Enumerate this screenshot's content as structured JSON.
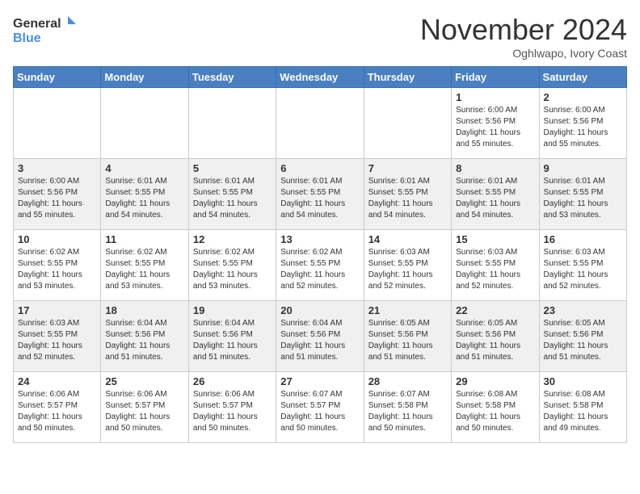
{
  "header": {
    "logo_general": "General",
    "logo_blue": "Blue",
    "month_title": "November 2024",
    "location": "Oghlwapo, Ivory Coast"
  },
  "days_of_week": [
    "Sunday",
    "Monday",
    "Tuesday",
    "Wednesday",
    "Thursday",
    "Friday",
    "Saturday"
  ],
  "weeks": [
    [
      {
        "day": "",
        "info": ""
      },
      {
        "day": "",
        "info": ""
      },
      {
        "day": "",
        "info": ""
      },
      {
        "day": "",
        "info": ""
      },
      {
        "day": "",
        "info": ""
      },
      {
        "day": "1",
        "info": "Sunrise: 6:00 AM\nSunset: 5:56 PM\nDaylight: 11 hours and 55 minutes."
      },
      {
        "day": "2",
        "info": "Sunrise: 6:00 AM\nSunset: 5:56 PM\nDaylight: 11 hours and 55 minutes."
      }
    ],
    [
      {
        "day": "3",
        "info": "Sunrise: 6:00 AM\nSunset: 5:56 PM\nDaylight: 11 hours and 55 minutes."
      },
      {
        "day": "4",
        "info": "Sunrise: 6:01 AM\nSunset: 5:55 PM\nDaylight: 11 hours and 54 minutes."
      },
      {
        "day": "5",
        "info": "Sunrise: 6:01 AM\nSunset: 5:55 PM\nDaylight: 11 hours and 54 minutes."
      },
      {
        "day": "6",
        "info": "Sunrise: 6:01 AM\nSunset: 5:55 PM\nDaylight: 11 hours and 54 minutes."
      },
      {
        "day": "7",
        "info": "Sunrise: 6:01 AM\nSunset: 5:55 PM\nDaylight: 11 hours and 54 minutes."
      },
      {
        "day": "8",
        "info": "Sunrise: 6:01 AM\nSunset: 5:55 PM\nDaylight: 11 hours and 54 minutes."
      },
      {
        "day": "9",
        "info": "Sunrise: 6:01 AM\nSunset: 5:55 PM\nDaylight: 11 hours and 53 minutes."
      }
    ],
    [
      {
        "day": "10",
        "info": "Sunrise: 6:02 AM\nSunset: 5:55 PM\nDaylight: 11 hours and 53 minutes."
      },
      {
        "day": "11",
        "info": "Sunrise: 6:02 AM\nSunset: 5:55 PM\nDaylight: 11 hours and 53 minutes."
      },
      {
        "day": "12",
        "info": "Sunrise: 6:02 AM\nSunset: 5:55 PM\nDaylight: 11 hours and 53 minutes."
      },
      {
        "day": "13",
        "info": "Sunrise: 6:02 AM\nSunset: 5:55 PM\nDaylight: 11 hours and 52 minutes."
      },
      {
        "day": "14",
        "info": "Sunrise: 6:03 AM\nSunset: 5:55 PM\nDaylight: 11 hours and 52 minutes."
      },
      {
        "day": "15",
        "info": "Sunrise: 6:03 AM\nSunset: 5:55 PM\nDaylight: 11 hours and 52 minutes."
      },
      {
        "day": "16",
        "info": "Sunrise: 6:03 AM\nSunset: 5:55 PM\nDaylight: 11 hours and 52 minutes."
      }
    ],
    [
      {
        "day": "17",
        "info": "Sunrise: 6:03 AM\nSunset: 5:55 PM\nDaylight: 11 hours and 52 minutes."
      },
      {
        "day": "18",
        "info": "Sunrise: 6:04 AM\nSunset: 5:56 PM\nDaylight: 11 hours and 51 minutes."
      },
      {
        "day": "19",
        "info": "Sunrise: 6:04 AM\nSunset: 5:56 PM\nDaylight: 11 hours and 51 minutes."
      },
      {
        "day": "20",
        "info": "Sunrise: 6:04 AM\nSunset: 5:56 PM\nDaylight: 11 hours and 51 minutes."
      },
      {
        "day": "21",
        "info": "Sunrise: 6:05 AM\nSunset: 5:56 PM\nDaylight: 11 hours and 51 minutes."
      },
      {
        "day": "22",
        "info": "Sunrise: 6:05 AM\nSunset: 5:56 PM\nDaylight: 11 hours and 51 minutes."
      },
      {
        "day": "23",
        "info": "Sunrise: 6:05 AM\nSunset: 5:56 PM\nDaylight: 11 hours and 51 minutes."
      }
    ],
    [
      {
        "day": "24",
        "info": "Sunrise: 6:06 AM\nSunset: 5:57 PM\nDaylight: 11 hours and 50 minutes."
      },
      {
        "day": "25",
        "info": "Sunrise: 6:06 AM\nSunset: 5:57 PM\nDaylight: 11 hours and 50 minutes."
      },
      {
        "day": "26",
        "info": "Sunrise: 6:06 AM\nSunset: 5:57 PM\nDaylight: 11 hours and 50 minutes."
      },
      {
        "day": "27",
        "info": "Sunrise: 6:07 AM\nSunset: 5:57 PM\nDaylight: 11 hours and 50 minutes."
      },
      {
        "day": "28",
        "info": "Sunrise: 6:07 AM\nSunset: 5:58 PM\nDaylight: 11 hours and 50 minutes."
      },
      {
        "day": "29",
        "info": "Sunrise: 6:08 AM\nSunset: 5:58 PM\nDaylight: 11 hours and 50 minutes."
      },
      {
        "day": "30",
        "info": "Sunrise: 6:08 AM\nSunset: 5:58 PM\nDaylight: 11 hours and 49 minutes."
      }
    ]
  ]
}
